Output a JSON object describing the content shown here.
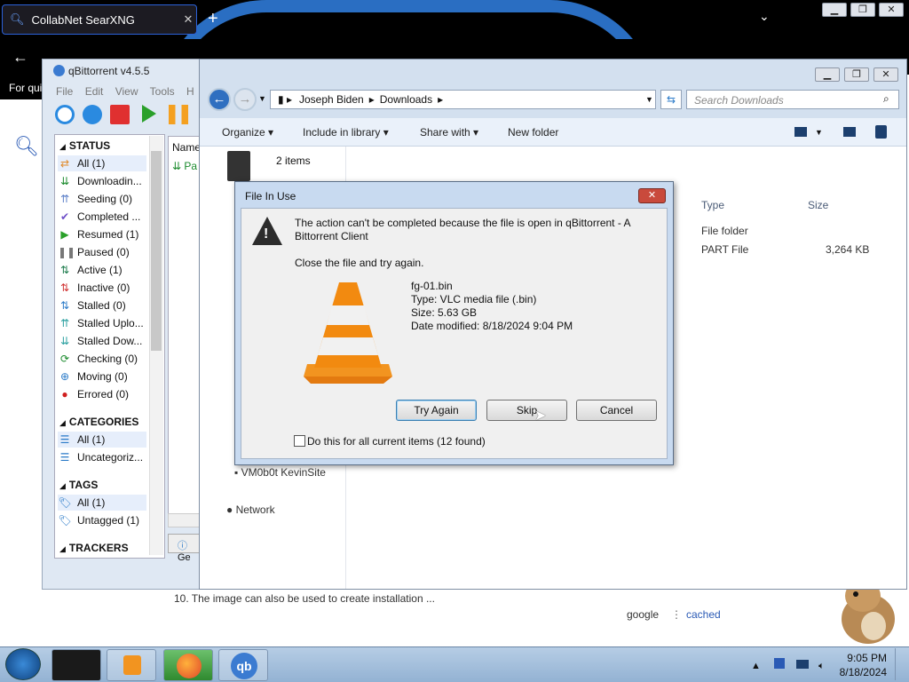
{
  "browser": {
    "tab_title": "CollabNet SearXNG",
    "tab_close": "✕",
    "new_tab": "+",
    "tab_list": "⌄",
    "quick_bar": "For qui"
  },
  "searx": {
    "result_text": "10. The image can also be used to create installation ...",
    "link_google": "google",
    "link_sep": "⋮",
    "link_cached": "cached"
  },
  "qbittorrent": {
    "title": "qBittorrent v4.5.5",
    "menu": [
      "File",
      "Edit",
      "View",
      "Tools",
      "H"
    ],
    "sections": {
      "status": "STATUS",
      "categories": "CATEGORIES",
      "tags": "TAGS",
      "trackers": "TRACKERS"
    },
    "status_items": [
      {
        "label": "All (1)",
        "icon": "shuffle-icon",
        "color": "#e08a2a"
      },
      {
        "label": "Downloadin...",
        "icon": "download-icon",
        "color": "#1a8a2c"
      },
      {
        "label": "Seeding (0)",
        "icon": "upload-icon",
        "color": "#5b7fc8"
      },
      {
        "label": "Completed ...",
        "icon": "check-icon",
        "color": "#6e4fc8"
      },
      {
        "label": "Resumed (1)",
        "icon": "play-icon",
        "color": "#2aa02a"
      },
      {
        "label": "Paused (0)",
        "icon": "pause-icon",
        "color": "#777777"
      },
      {
        "label": "Active (1)",
        "icon": "updown-icon",
        "color": "#1a7a4a"
      },
      {
        "label": "Inactive (0)",
        "icon": "updown-icon",
        "color": "#d03030"
      },
      {
        "label": "Stalled (0)",
        "icon": "updown-icon",
        "color": "#2a7ac8"
      },
      {
        "label": "Stalled Uplo...",
        "icon": "upload-icon",
        "color": "#2aa0a0"
      },
      {
        "label": "Stalled Dow...",
        "icon": "download-icon",
        "color": "#2aa0a0"
      },
      {
        "label": "Checking (0)",
        "icon": "refresh-icon",
        "color": "#1a8a2c"
      },
      {
        "label": "Moving (0)",
        "icon": "move-icon",
        "color": "#2a7ac8"
      },
      {
        "label": "Errored (0)",
        "icon": "error-icon",
        "color": "#d02020"
      }
    ],
    "category_items": [
      "All (1)",
      "Uncategoriz..."
    ],
    "tag_items": [
      "All (1)",
      "Untagged (1)"
    ],
    "list_header": "Name",
    "list_row": "Pa",
    "status_bar": "Ge"
  },
  "explorer": {
    "breadcrumb": [
      "Joseph Biden",
      "Downloads"
    ],
    "search_placeholder": "Search Downloads",
    "toolbar": {
      "organize": "Organize",
      "include": "Include in library",
      "share": "Share with",
      "new_folder": "New folder"
    },
    "item_count": "2 items",
    "columns": {
      "type": "Type",
      "size": "Size"
    },
    "rows": [
      {
        "type": "File folder",
        "size": ""
      },
      {
        "type": "PART File",
        "size": "3,264 KB"
      }
    ],
    "nav_items": [
      "VM0b0t KevinSite",
      "Network"
    ]
  },
  "dialog": {
    "title": "File In Use",
    "message": "The action can't be completed because the file is open in qBittorrent - A Bittorrent Client",
    "message2": "Close the file and try again.",
    "file_name": "fg-01.bin",
    "file_type": "Type: VLC media file (.bin)",
    "file_size": "Size: 5.63 GB",
    "file_date": "Date modified: 8/18/2024 9:04 PM",
    "btn_try_again": "Try Again",
    "btn_skip": "Skip",
    "btn_cancel": "Cancel",
    "checkbox_label": "Do this for all current items (12 found)"
  },
  "taskbar": {
    "time": "9:05 PM",
    "date": "8/18/2024"
  }
}
